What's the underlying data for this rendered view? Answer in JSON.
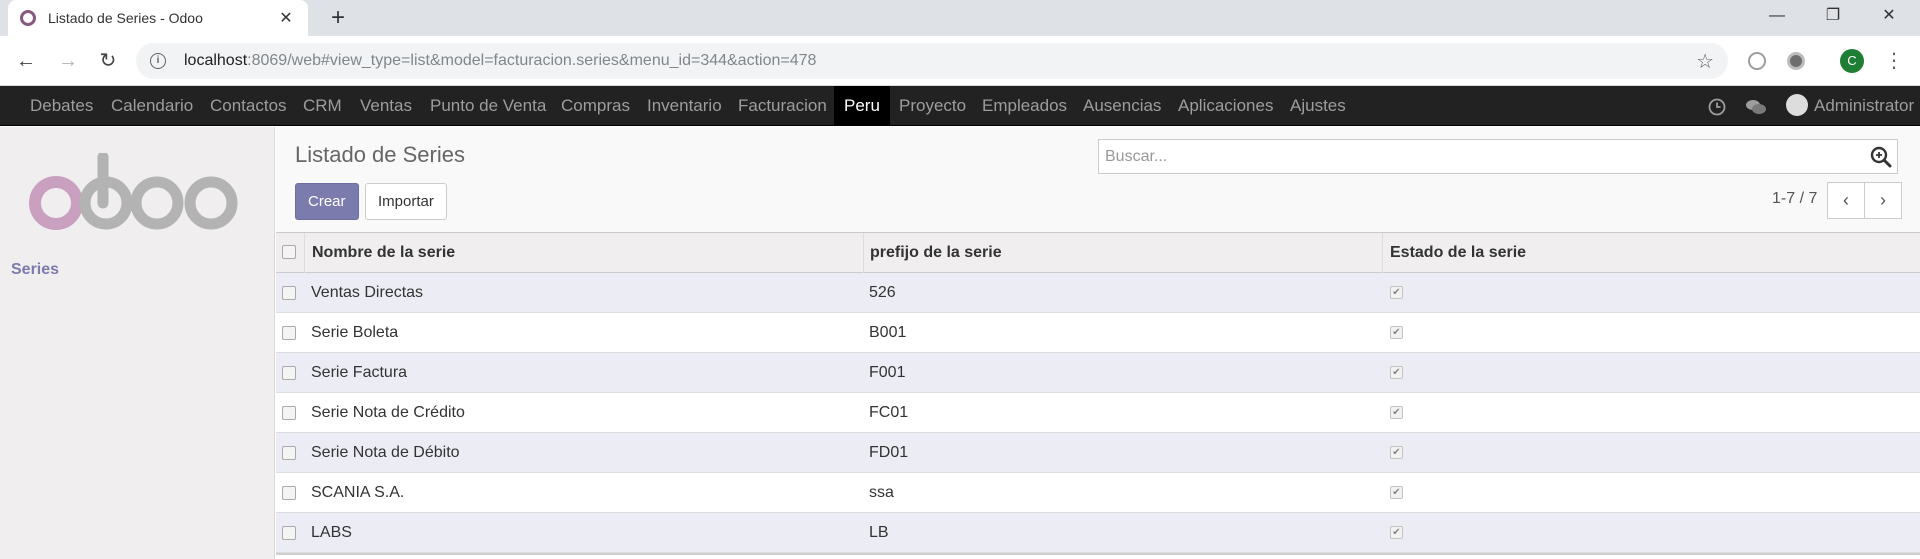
{
  "browser": {
    "tab_title": "Listado de Series - Odoo",
    "url_host": "localhost",
    "url_rest": ":8069/web#view_type=list&model=facturacion.series&menu_id=344&action=478",
    "profile_initial": "C"
  },
  "top_menu": {
    "items": [
      "Debates",
      "Calendario",
      "Contactos",
      "CRM",
      "Ventas",
      "Punto de Venta",
      "Compras",
      "Inventario",
      "Facturacion",
      "Peru",
      "Proyecto",
      "Empleados",
      "Ausencias",
      "Aplicaciones",
      "Ajustes"
    ],
    "active": "Peru",
    "user_name": "Administrator"
  },
  "sidebar": {
    "logo_text": "odoo",
    "items": [
      "Series"
    ]
  },
  "control_panel": {
    "title": "Listado de Series",
    "create_label": "Crear",
    "import_label": "Importar",
    "search_placeholder": "Buscar...",
    "pager_value": "1-7 / 7"
  },
  "table": {
    "headers": [
      "Nombre de la serie",
      "prefijo de la serie",
      "Estado de la serie"
    ],
    "rows": [
      {
        "nombre": "Ventas Directas",
        "prefijo": "526",
        "estado": true
      },
      {
        "nombre": "Serie Boleta",
        "prefijo": "B001",
        "estado": true
      },
      {
        "nombre": "Serie Factura",
        "prefijo": "F001",
        "estado": true
      },
      {
        "nombre": "Serie Nota de Crédito",
        "prefijo": "FC01",
        "estado": true
      },
      {
        "nombre": "Serie Nota de Débito",
        "prefijo": "FD01",
        "estado": true
      },
      {
        "nombre": "SCANIA S.A.",
        "prefijo": "ssa",
        "estado": true
      },
      {
        "nombre": "LABS",
        "prefijo": "LB",
        "estado": true
      }
    ]
  },
  "colors": {
    "odoo_purple": "#7c7bad",
    "odoo_logo_pink": "#c9a0c0",
    "nav_bg": "#222222"
  }
}
